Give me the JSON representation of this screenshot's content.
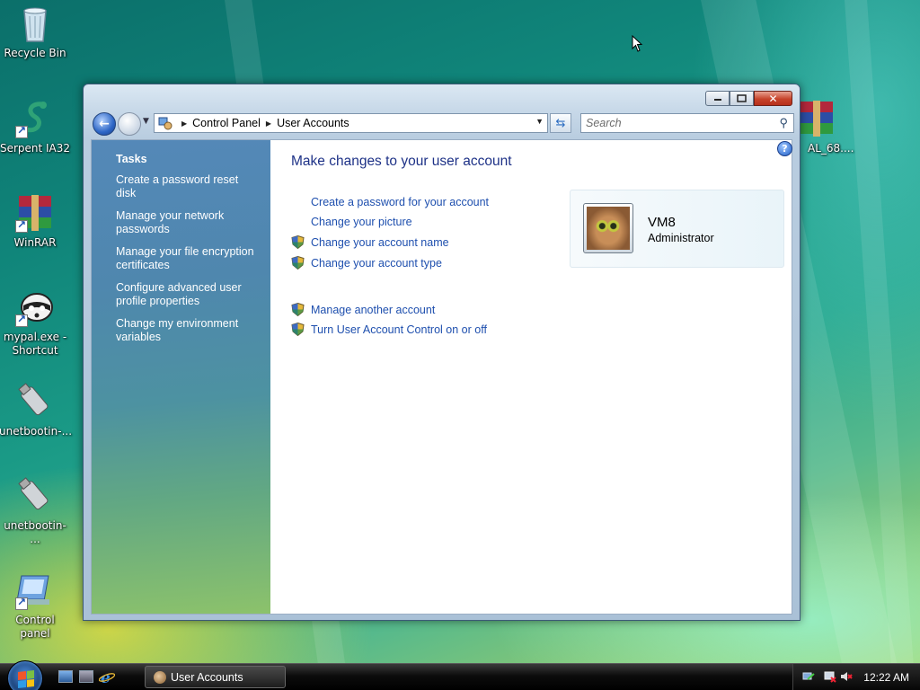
{
  "desktop": {
    "icons": [
      {
        "label": "Recycle Bin",
        "icon": "recycle-bin-icon"
      },
      {
        "label": "Serpent IA32",
        "icon": "serpent-icon"
      },
      {
        "label": "WinRAR",
        "icon": "winrar-icon"
      },
      {
        "label": "mypal.exe - Shortcut",
        "icon": "mypal-icon"
      },
      {
        "label": "unetbootin-...",
        "icon": "usb-drive-icon"
      },
      {
        "label": "unetbootin- ...",
        "icon": "usb-drive-icon"
      },
      {
        "label": "Control panel",
        "icon": "control-panel-icon"
      },
      {
        "label": "AL_68....",
        "icon": "winrar-archive-icon"
      }
    ]
  },
  "window": {
    "caption_buttons": {
      "minimize": "minimize",
      "maximize": "maximize",
      "close": "✕"
    },
    "address": {
      "crumbs": [
        "Control Panel",
        "User Accounts"
      ]
    },
    "search": {
      "placeholder": "Search"
    },
    "help": "?",
    "tasks": {
      "heading": "Tasks",
      "items": [
        "Create a password reset disk",
        "Manage your network passwords",
        "Manage your file encryption certificates",
        "Configure advanced user profile properties",
        "Change my environment variables"
      ]
    },
    "main": {
      "title": "Make changes to your user account",
      "links": [
        {
          "label": "Create a password for your account",
          "shield": false
        },
        {
          "label": "Change your picture",
          "shield": false
        },
        {
          "label": "Change your account name",
          "shield": true
        },
        {
          "label": "Change your account type",
          "shield": true
        },
        {
          "label": "Manage another account",
          "shield": true
        },
        {
          "label": "Turn User Account Control on or off",
          "shield": true
        }
      ],
      "user": {
        "name": "VM8",
        "role": "Administrator"
      }
    }
  },
  "taskbar": {
    "active_task": "User Accounts",
    "clock": "12:22 AM"
  },
  "colors": {
    "link": "#1e4fae",
    "title": "#1e3287",
    "task_pane_top": "#5488b8",
    "task_pane_bottom": "#8cc26b"
  }
}
